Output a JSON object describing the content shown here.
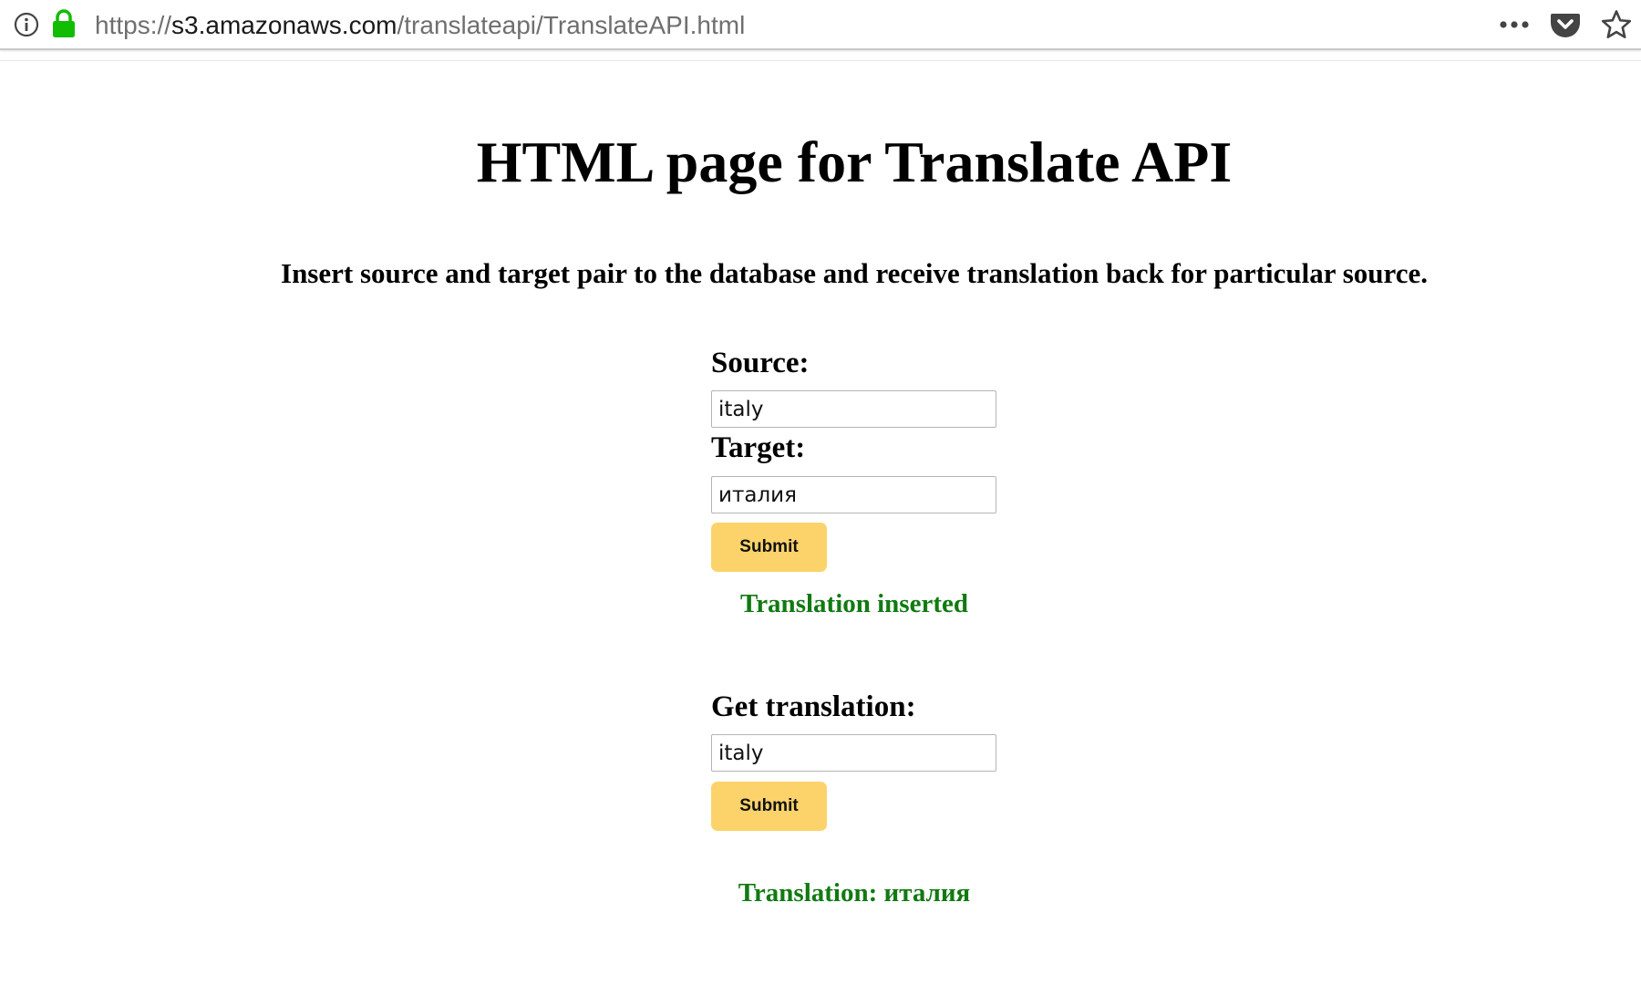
{
  "browser": {
    "url_scheme": "https://",
    "url_host": "s3.amazonaws.com",
    "url_path": "/translateapi/TranslateAPI.html",
    "icons": [
      "info-icon",
      "lock-icon",
      "more-icon",
      "pocket-icon",
      "star-icon"
    ],
    "lock_color": "#12bc00"
  },
  "page": {
    "title": "HTML page for Translate API",
    "subtitle": "Insert source and target pair to the database and receive translation back for particular source."
  },
  "insert_form": {
    "source_label": "Source:",
    "source_value": "italy",
    "target_label": "Target:",
    "target_value": "италия",
    "submit_label": "Submit",
    "status": "Translation inserted"
  },
  "get_form": {
    "label": "Get translation:",
    "value": "italy",
    "submit_label": "Submit",
    "result": "Translation: италия"
  },
  "colors": {
    "button": "#fcd36a",
    "status_text": "#117a11"
  }
}
